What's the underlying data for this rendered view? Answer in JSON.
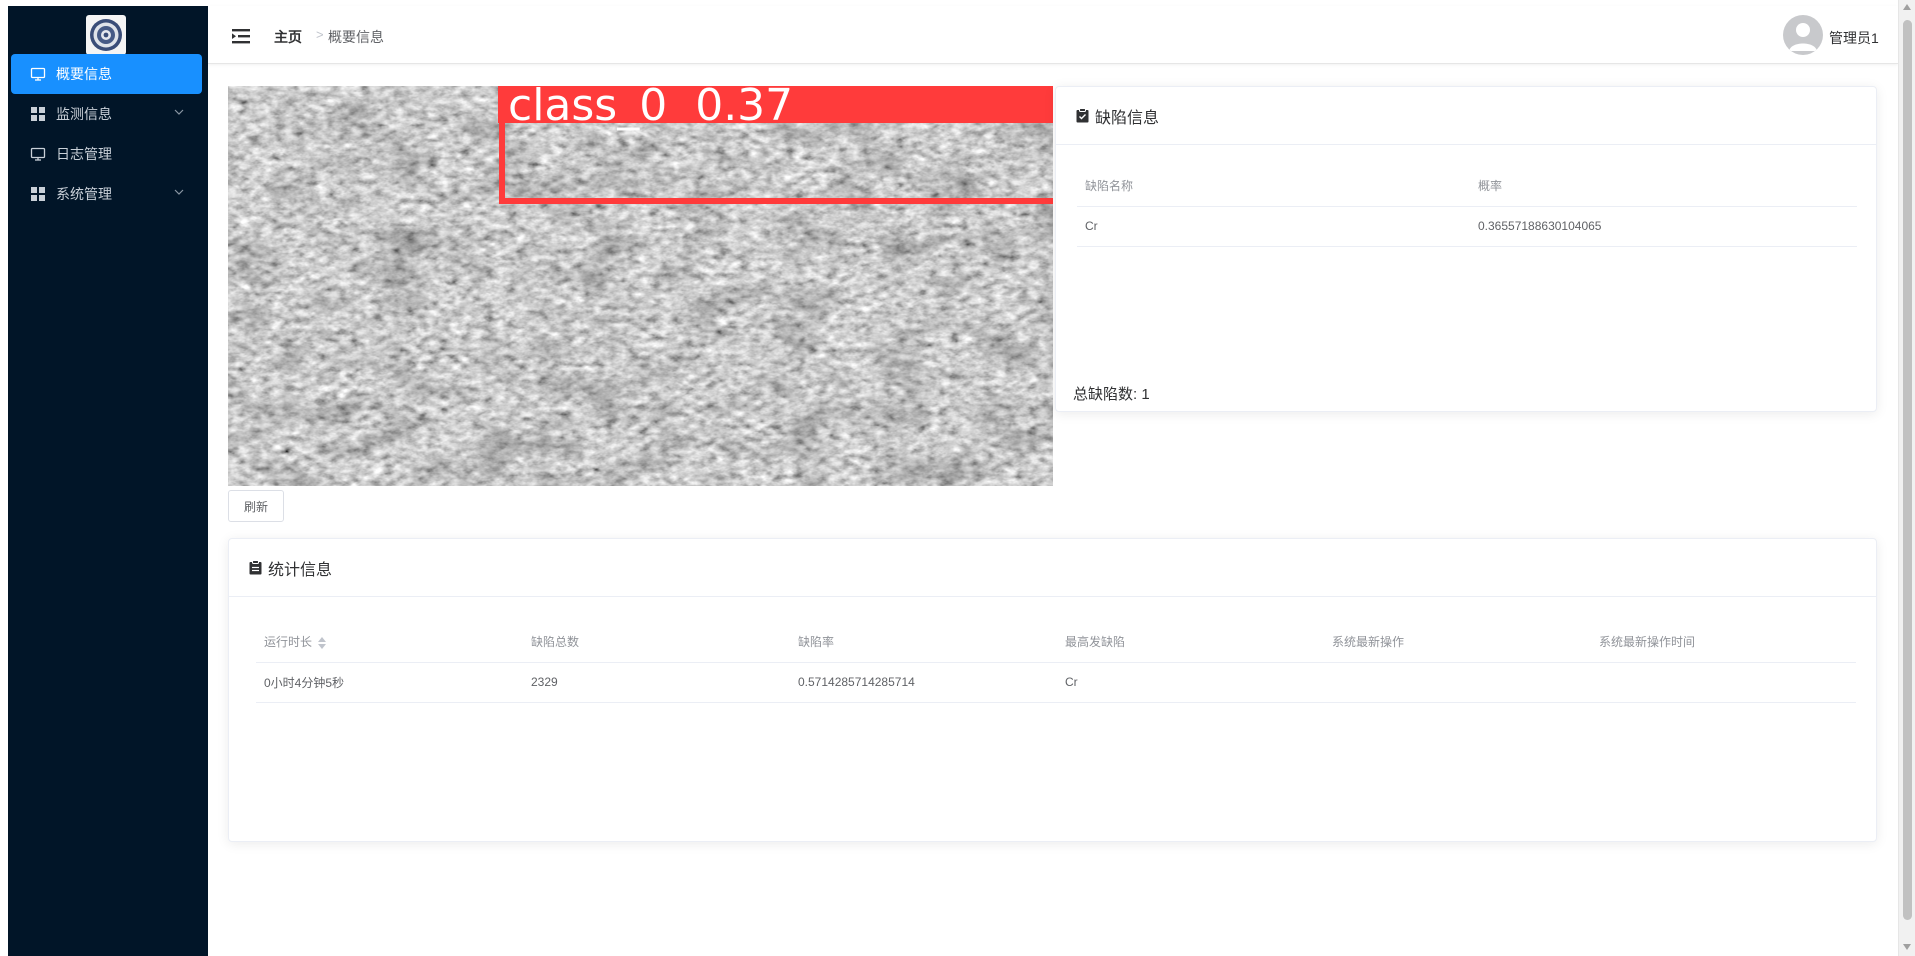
{
  "sidebar": {
    "items": [
      {
        "label": "概要信息",
        "icon": "monitor-icon",
        "active": true
      },
      {
        "label": "监测信息",
        "icon": "grid-icon",
        "has_children": true
      },
      {
        "label": "日志管理",
        "icon": "monitor-icon"
      },
      {
        "label": "系统管理",
        "icon": "grid-icon",
        "has_children": true
      }
    ],
    "bg_color": "#011528",
    "active_color": "#1890ff"
  },
  "header": {
    "breadcrumb_home": "主页",
    "breadcrumb_current": "概要信息",
    "user_name": "管理员1"
  },
  "detection": {
    "label": "class_0  0.37",
    "box_color": "#ff3b3b"
  },
  "refresh_label": "刷新",
  "defect_card": {
    "title": "缺陷信息",
    "columns": [
      "缺陷名称",
      "概率"
    ],
    "rows": [
      [
        "Cr",
        "0.36557188630104065"
      ]
    ],
    "total_label": "总缺陷数: 1"
  },
  "stats_card": {
    "title": "统计信息",
    "columns": [
      "运行时长",
      "缺陷总数",
      "缺陷率",
      "最高发缺陷",
      "系统最新操作",
      "系统最新操作时间"
    ],
    "rows": [
      [
        "0小时4分钟5秒",
        "2329",
        "0.5714285714285714",
        "Cr",
        "",
        ""
      ]
    ]
  }
}
